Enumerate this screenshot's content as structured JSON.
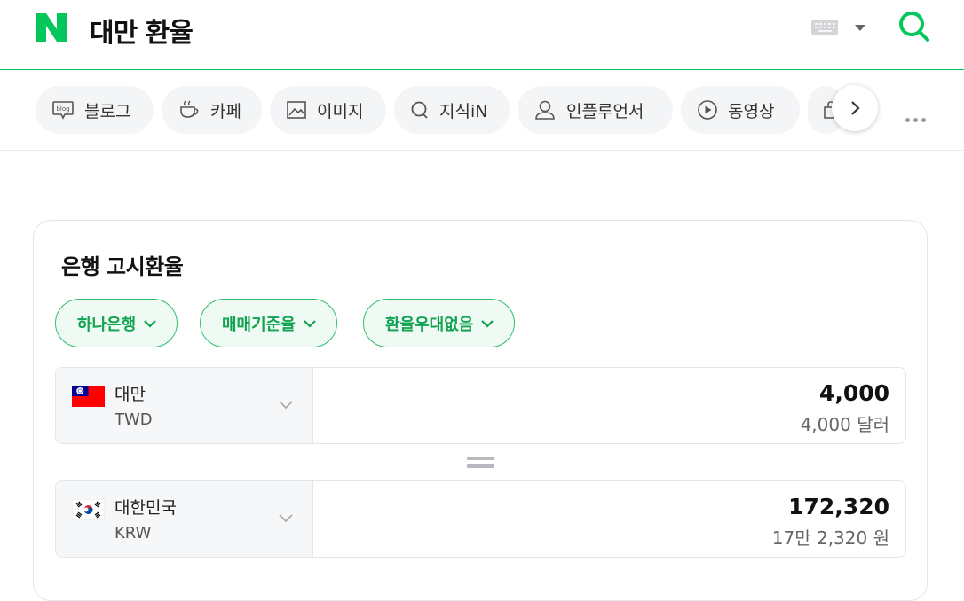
{
  "header": {
    "query": "대만 환율",
    "accent_color": "#03c75a"
  },
  "tabs": [
    {
      "label": "블로그",
      "icon": "blog-icon"
    },
    {
      "label": "카페",
      "icon": "cafe-cup-icon"
    },
    {
      "label": "이미지",
      "icon": "image-icon"
    },
    {
      "label": "지식iN",
      "icon": "knowledge-q-icon"
    },
    {
      "label": "인플루언서",
      "icon": "person-icon"
    },
    {
      "label": "동영상",
      "icon": "play-icon"
    }
  ],
  "exchange": {
    "title": "은행 고시환율",
    "filters": [
      {
        "label": "하나은행"
      },
      {
        "label": "매매기준율"
      },
      {
        "label": "환율우대없음"
      }
    ],
    "from": {
      "country": "대만",
      "code": "TWD",
      "amount": "4,000",
      "amount_text": "4,000 달러",
      "flag": "taiwan-flag-icon"
    },
    "to": {
      "country": "대한민국",
      "code": "KRW",
      "amount": "172,320",
      "amount_text": "17만 2,320 원",
      "flag": "korea-flag-icon"
    }
  }
}
